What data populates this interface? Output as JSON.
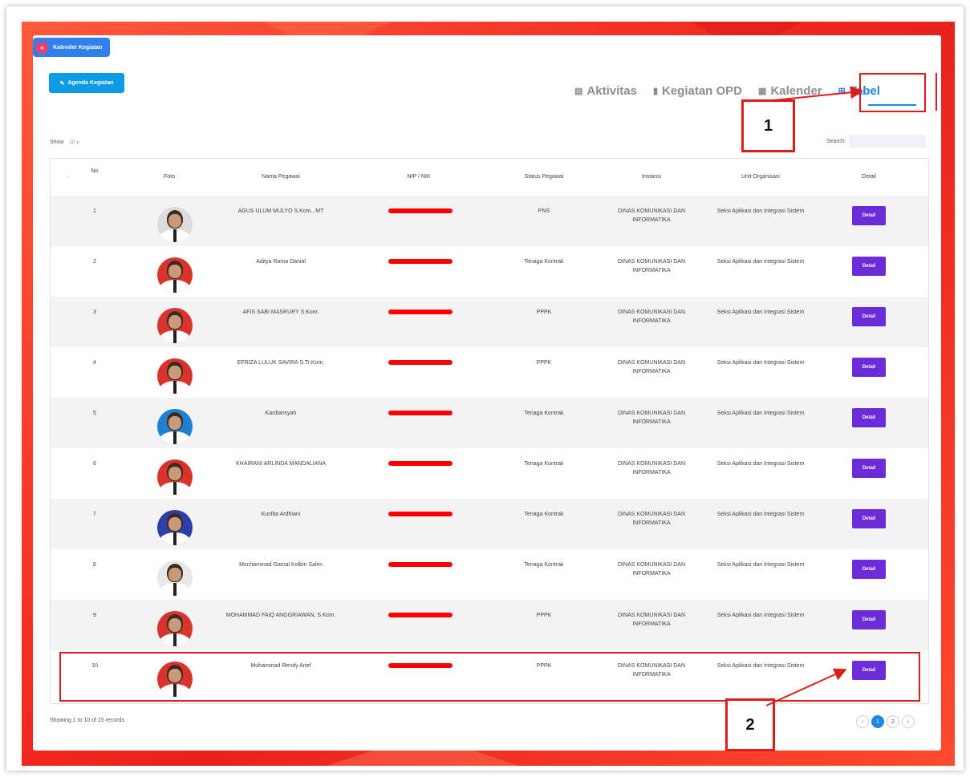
{
  "header": {
    "kalender_btn_label": "Kalender Kegiatan",
    "kalender_btn_icon": "double-chevron-left-icon",
    "agenda_btn_label": "Agenda Kegiatan",
    "agenda_btn_icon": "pencil-icon"
  },
  "tabs": [
    {
      "label": "Aktivitas",
      "icon": "list-icon",
      "active": false
    },
    {
      "label": "Kegiatan OPD",
      "icon": "clipboard-icon",
      "active": false
    },
    {
      "label": "Kalender",
      "icon": "calendar-icon",
      "active": false
    },
    {
      "label": "Tabel",
      "icon": "table-icon",
      "active": true
    }
  ],
  "controls": {
    "show_label": "Show",
    "show_value": "10",
    "search_label": "Search:"
  },
  "table": {
    "columns": [
      "No",
      "Foto",
      "Nama Pegawai",
      "NIP / NIK",
      "Status Pegawai",
      "Instansi",
      "Unit Organisasi",
      "Detail"
    ],
    "rows": [
      {
        "no": "1",
        "nama": "AGUS ULUM MULYO S.Kom., MT",
        "status": "PNS",
        "instansi": "DINAS KOMUNIKASI DAN INFORMATIKA",
        "unit": "Seksi Aplikasi dan Integrasi Sistem",
        "detail": "Detail",
        "avatar_bg": "#dcdcdc"
      },
      {
        "no": "2",
        "nama": "Aditya Rama Danial",
        "status": "Tenaga Kontrak",
        "instansi": "DINAS KOMUNIKASI DAN INFORMATIKA",
        "unit": "Seksi Aplikasi dan Integrasi Sistem",
        "detail": "Detail",
        "avatar_bg": "#d9332b"
      },
      {
        "no": "3",
        "nama": "AFIS SABI MASRURY S.Kom.",
        "status": "PPPK",
        "instansi": "DINAS KOMUNIKASI DAN INFORMATIKA",
        "unit": "Seksi Aplikasi dan Integrasi Sistem",
        "detail": "Detail",
        "avatar_bg": "#d9332b"
      },
      {
        "no": "4",
        "nama": "EFRIZA LULUK SAVIRA S.Tr.Kom.",
        "status": "PPPK",
        "instansi": "DINAS KOMUNIKASI DAN INFORMATIKA",
        "unit": "Seksi Aplikasi dan Integrasi Sistem",
        "detail": "Detail",
        "avatar_bg": "#d9332b"
      },
      {
        "no": "5",
        "nama": "Kardiansyah",
        "status": "Tenaga Kontrak",
        "instansi": "DINAS KOMUNIKASI DAN INFORMATIKA",
        "unit": "Seksi Aplikasi dan Integrasi Sistem",
        "detail": "Detail",
        "avatar_bg": "#1f7fd0"
      },
      {
        "no": "6",
        "nama": "KHAIRANI ARLINDA MANDALIANA",
        "status": "Tenaga Kontrak",
        "instansi": "DINAS KOMUNIKASI DAN INFORMATIKA",
        "unit": "Seksi Aplikasi dan Integrasi Sistem",
        "detail": "Detail",
        "avatar_bg": "#d9332b"
      },
      {
        "no": "7",
        "nama": "Kusfita Ardhiani",
        "status": "Tenaga Kontrak",
        "instansi": "DINAS KOMUNIKASI DAN INFORMATIKA",
        "unit": "Seksi Aplikasi dan Integrasi Sistem",
        "detail": "Detail",
        "avatar_bg": "#2c3fa8"
      },
      {
        "no": "8",
        "nama": "Mochammad Gamal Kolbin Salim",
        "status": "Tenaga Kontrak",
        "instansi": "DINAS KOMUNIKASI DAN INFORMATIKA",
        "unit": "Seksi Aplikasi dan Integrasi Sistem",
        "detail": "Detail",
        "avatar_bg": "#e8e8e8"
      },
      {
        "no": "9",
        "nama": "MOHAMMAD FAIQ ANGGRIAWAN, S.Kom.",
        "status": "PPPK",
        "instansi": "DINAS KOMUNIKASI DAN INFORMATIKA",
        "unit": "Seksi Aplikasi dan Integrasi Sistem",
        "detail": "Detail",
        "avatar_bg": "#d9332b"
      },
      {
        "no": "10",
        "nama": "Muhammad Rendy Arief",
        "status": "PPPK",
        "instansi": "DINAS KOMUNIKASI DAN INFORMATIKA",
        "unit": "Seksi Aplikasi dan Integrasi Sistem",
        "detail": "Detail",
        "avatar_bg": "#d9332b"
      }
    ]
  },
  "footer": {
    "showing_text": "Showing 1 to 10 of 15 records",
    "pages": [
      "1",
      "2"
    ],
    "current_page": "1"
  },
  "annotations": {
    "badge1": "1",
    "badge2": "2",
    "color": "#e01b1b"
  }
}
